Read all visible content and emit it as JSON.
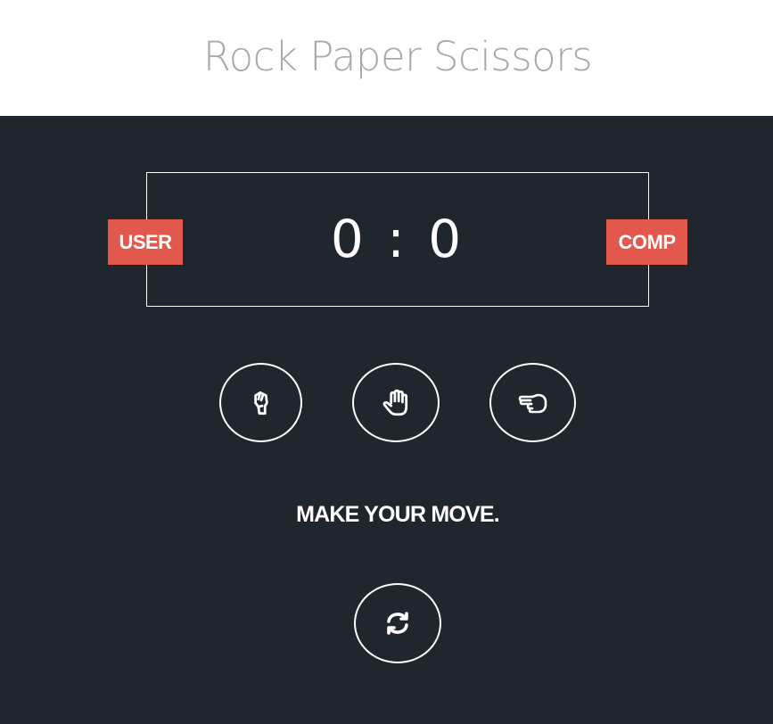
{
  "header": {
    "title": "Rock Paper Scissors"
  },
  "scoreboard": {
    "user_label": "USER",
    "comp_label": "COMP",
    "score_text": "0 : 0",
    "user_score": 0,
    "comp_score": 0
  },
  "choices": [
    {
      "name": "rock",
      "icon": "hand-rock-icon"
    },
    {
      "name": "paper",
      "icon": "hand-paper-icon"
    },
    {
      "name": "scissors",
      "icon": "hand-scissors-icon"
    }
  ],
  "status": {
    "message": "MAKE YOUR MOVE."
  },
  "reset": {
    "icon": "refresh-icon"
  },
  "colors": {
    "board_bg": "#20262e",
    "header_bg": "#ffffff",
    "title_color": "#a9a9a9",
    "badge_bg": "#e2584d",
    "foreground": "#ffffff"
  }
}
